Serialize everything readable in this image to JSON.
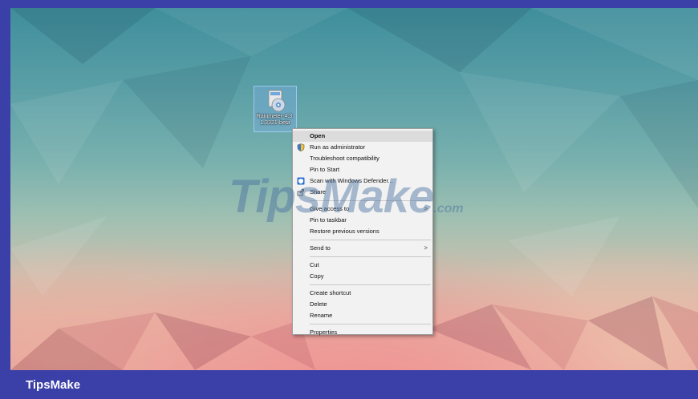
{
  "desktop_icon": {
    "label": "Rainmeter-4.3.1.3321-beta",
    "icon": "installer-disc-icon"
  },
  "context_menu": {
    "groups": [
      [
        {
          "label": "Open",
          "bold": true,
          "highlighted": true,
          "icon": ""
        },
        {
          "label": "Run as administrator",
          "icon": "shield-icon"
        },
        {
          "label": "Troubleshoot compatibility",
          "icon": ""
        },
        {
          "label": "Pin to Start",
          "icon": ""
        },
        {
          "label": "Scan with Windows Defender...",
          "icon": "defender-icon"
        },
        {
          "label": "Share",
          "icon": "share-icon"
        }
      ],
      [
        {
          "label": "Give access to",
          "submenu": true,
          "icon": ""
        },
        {
          "label": "Pin to taskbar",
          "icon": ""
        },
        {
          "label": "Restore previous versions",
          "icon": ""
        }
      ],
      [
        {
          "label": "Send to",
          "submenu": true,
          "icon": ""
        }
      ],
      [
        {
          "label": "Cut",
          "icon": ""
        },
        {
          "label": "Copy",
          "icon": ""
        }
      ],
      [
        {
          "label": "Create shortcut",
          "icon": ""
        },
        {
          "label": "Delete",
          "icon": ""
        },
        {
          "label": "Rename",
          "icon": ""
        }
      ],
      [
        {
          "label": "Properties",
          "icon": ""
        }
      ]
    ],
    "submenu_glyph": ">"
  },
  "watermark": {
    "main": "TipsMake",
    "suffix": ".com"
  },
  "footer": {
    "brand": "TipsMake"
  },
  "colors": {
    "frame": "#3b3fa8",
    "menu_bg": "#f2f2f2",
    "menu_highlight": "#dcdcdc"
  }
}
